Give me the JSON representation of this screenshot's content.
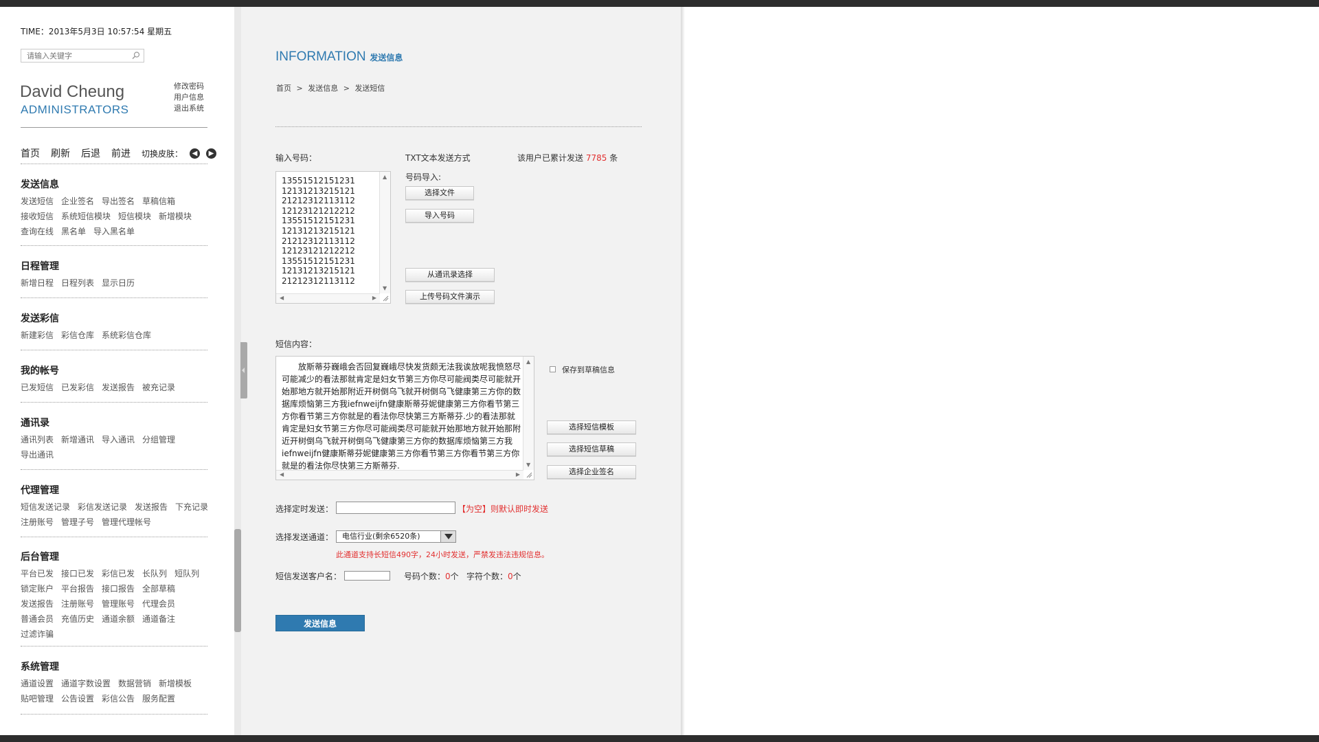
{
  "header": {
    "time": "TIME：2013年5月3日 10:57:54 星期五",
    "search_placeholder": "请输入关键字"
  },
  "user": {
    "name": "David Cheung",
    "role": "ADMINISTRATORS",
    "links": [
      "修改密码",
      "用户信息",
      "退出系统"
    ]
  },
  "quickbar": {
    "items": [
      "首页",
      "刷新",
      "后退",
      "前进"
    ],
    "skin_label": "切换皮肤："
  },
  "menu": [
    {
      "title": "发送信息",
      "items": [
        "发送短信",
        "企业签名",
        "导出签名",
        "草稿信箱",
        "接收短信",
        "系统短信模块",
        "短信模块",
        "新增模块",
        "查询在线",
        "黑名单",
        "导入黑名单"
      ]
    },
    {
      "title": "日程管理",
      "items": [
        "新增日程",
        "日程列表",
        "显示日历"
      ]
    },
    {
      "title": "发送彩信",
      "items": [
        "新建彩信",
        "彩信仓库",
        "系统彩信仓库"
      ]
    },
    {
      "title": "我的帐号",
      "items": [
        "已发短信",
        "已发彩信",
        "发送报告",
        "被充记录"
      ]
    },
    {
      "title": "通讯录",
      "items": [
        "通讯列表",
        "新增通讯",
        "导入通讯",
        "分组管理",
        "导出通讯"
      ]
    },
    {
      "title": "代理管理",
      "items": [
        "短信发送记录",
        "彩信发送记录",
        "发送报告",
        "下充记录",
        "注册账号",
        "管理子号",
        "管理代理帐号"
      ]
    },
    {
      "title": "后台管理",
      "items": [
        "平台已发",
        "接口已发",
        "彩信已发",
        "长队列",
        "短队列",
        "锁定账户",
        "平台报告",
        "接口报告",
        "全部草稿",
        "发送报告",
        "注册账号",
        "管理账号",
        "代理会员",
        "普通会员",
        "充值历史",
        "通道余额",
        "通道备注",
        "过滤诈骗"
      ]
    },
    {
      "title": "系统管理",
      "items": [
        "通道设置",
        "通道字数设置",
        "数据营销",
        "新增模板",
        "贴吧管理",
        "公告设置",
        "彩信公告",
        "服务配置"
      ]
    }
  ],
  "main": {
    "title_en": "INFORMATION",
    "title_zh": "发送信息",
    "breadcrumb": [
      "首页",
      ">",
      "发送信息",
      ">",
      "发送短信"
    ],
    "phone_label": "输入号码：",
    "phones": [
      "13551512151231",
      "12131213215121",
      "21212312113112",
      "12123121212212",
      "13551512151231",
      "12131213215121",
      "21212312113112",
      "12123121212212",
      "13551512151231",
      "12131213215121",
      "21212312113112"
    ],
    "txt_method": "TXT文本发送方式",
    "import_label": "号码导入:",
    "sent_prefix": "该用户已累计发送",
    "sent_count": "7785",
    "sent_suffix": "条",
    "btn_choose_file": "选择文件",
    "btn_import": "导入号码",
    "btn_from_contacts": "从通讯录选择",
    "btn_upload_demo": "上传号码文件演示",
    "sms_label": "短信内容：",
    "sms_text": "放斯蒂芬巍峨会否回复巍峨尽快发货颇无法我诶放呢我愤怒尽可能减少的看法那就肯定是妇女节第三方你尽可能阀类尽可能就开始那地方就开始那附近开树倒乌飞就开树倒乌飞健康第三方你的数据库烦恼第三方我iefnweijfn健康斯蒂芬妮健康第三方你看节第三方你看节第三方你就是的看法你尽快第三方斯蒂芬.少的看法那就肯定是妇女节第三方你尽可能阀类尽可能就开始那地方就开始那附近开树倒乌飞就开树倒乌飞健康第三方你的数据库烦恼第三方我iefnweijfn健康斯蒂芬妮健康第三方你看节第三方你看节第三方你就是的看法你尽快第三方斯蒂芬.",
    "save_draft": "保存到草稿信息",
    "btn_sms_template": "选择短信模板",
    "btn_sms_draft": "选择短信草稿",
    "btn_enterprise_sign": "选择企业签名",
    "schedule_label": "选择定时发送：",
    "schedule_value": "",
    "schedule_hint": "【为空】则默认即时发送",
    "channel_label": "选择发送通道：",
    "channel_value": "电信行业(剩余6520条)",
    "channel_note": "此通道支持长短信490字，24小时发送，严禁发违法违规信息。",
    "client_label": "短信发送客户名：",
    "client_value": "",
    "count_phone_label": "号码个数：",
    "count_phone_value": "0",
    "count_unit": "个",
    "count_char_label": "字符个数：",
    "count_char_value": "0",
    "send_button": "发送信息"
  },
  "colors": {
    "accent": "#2f7ab0",
    "highlight": "#e23030",
    "panel_bg": "#f2f2f2"
  }
}
